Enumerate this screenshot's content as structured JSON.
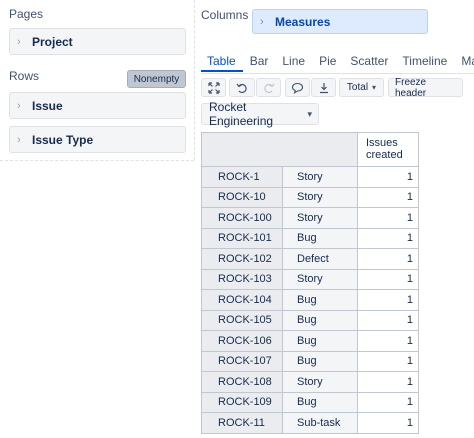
{
  "pages": {
    "title": "Pages",
    "items": [
      {
        "label": "Project"
      }
    ]
  },
  "rows": {
    "title": "Rows",
    "nonempty_label": "Nonempty",
    "items": [
      {
        "label": "Issue"
      },
      {
        "label": "Issue Type"
      }
    ]
  },
  "columns": {
    "title": "Columns",
    "items": [
      {
        "label": "Measures"
      }
    ]
  },
  "tabs": [
    {
      "label": "Table",
      "active": true
    },
    {
      "label": "Bar"
    },
    {
      "label": "Line"
    },
    {
      "label": "Pie"
    },
    {
      "label": "Scatter"
    },
    {
      "label": "Timeline"
    },
    {
      "label": "Map"
    }
  ],
  "toolbar": {
    "icons": [
      "expand-icon",
      "undo-icon",
      "redo-icon",
      "comment-icon",
      "export-icon"
    ],
    "total_label": "Total",
    "freeze_label": "Freeze header"
  },
  "project_selector": {
    "value": "Rocket Engineering"
  },
  "table": {
    "measure_header": [
      "Issues",
      "created"
    ],
    "rows": [
      {
        "issue": "ROCK-1",
        "type": "Story",
        "value": "1"
      },
      {
        "issue": "ROCK-10",
        "type": "Story",
        "value": "1"
      },
      {
        "issue": "ROCK-100",
        "type": "Story",
        "value": "1"
      },
      {
        "issue": "ROCK-101",
        "type": "Bug",
        "value": "1"
      },
      {
        "issue": "ROCK-102",
        "type": "Defect",
        "value": "1"
      },
      {
        "issue": "ROCK-103",
        "type": "Story",
        "value": "1"
      },
      {
        "issue": "ROCK-104",
        "type": "Bug",
        "value": "1"
      },
      {
        "issue": "ROCK-105",
        "type": "Bug",
        "value": "1"
      },
      {
        "issue": "ROCK-106",
        "type": "Bug",
        "value": "1"
      },
      {
        "issue": "ROCK-107",
        "type": "Bug",
        "value": "1"
      },
      {
        "issue": "ROCK-108",
        "type": "Story",
        "value": "1"
      },
      {
        "issue": "ROCK-109",
        "type": "Bug",
        "value": "1"
      },
      {
        "issue": "ROCK-11",
        "type": "Sub-task",
        "value": "1"
      }
    ]
  },
  "colors": {
    "accent": "#0052cc",
    "chip_blue": "#deebff",
    "border": "#dfe1e6"
  }
}
